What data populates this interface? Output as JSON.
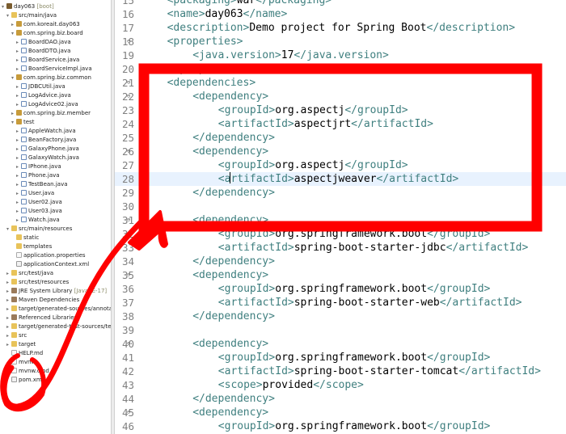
{
  "explorer": {
    "items": [
      {
        "text": "day063",
        "deco": " [boot]",
        "icon": "proj",
        "tw": "v"
      },
      {
        "text": "src/main/java",
        "icon": "folder",
        "tw": "v"
      },
      {
        "text": "com.koreait.day063",
        "icon": "pkg",
        "tw": ">"
      },
      {
        "text": "com.spring.biz.board",
        "icon": "pkg",
        "tw": "v"
      },
      {
        "text": "BoardDAO.java",
        "icon": "java",
        "tw": ">"
      },
      {
        "text": "BoardDTO.java",
        "icon": "java",
        "tw": ">"
      },
      {
        "text": "BoardService.java",
        "icon": "java",
        "tw": ">"
      },
      {
        "text": "BoardServiceImpl.java",
        "icon": "java",
        "tw": ">"
      },
      {
        "text": "com.spring.biz.common",
        "icon": "pkg",
        "tw": "v"
      },
      {
        "text": "JDBCUtil.java",
        "icon": "java",
        "tw": ">"
      },
      {
        "text": "LogAdvice.java",
        "icon": "java",
        "tw": ">"
      },
      {
        "text": "LogAdvice02.java",
        "icon": "java",
        "tw": ">"
      },
      {
        "text": "com.spring.biz.member",
        "icon": "pkg",
        "tw": ">"
      },
      {
        "text": "test",
        "icon": "pkg",
        "tw": "v"
      },
      {
        "text": "AppleWatch.java",
        "icon": "java",
        "tw": ">"
      },
      {
        "text": "BeanFactory.java",
        "icon": "java",
        "tw": ">"
      },
      {
        "text": "GalaxyPhone.java",
        "icon": "java",
        "tw": ">"
      },
      {
        "text": "GalaxyWatch.java",
        "icon": "java",
        "tw": ">"
      },
      {
        "text": "IPhone.java",
        "icon": "java",
        "tw": ">"
      },
      {
        "text": "Phone.java",
        "icon": "java",
        "tw": ">"
      },
      {
        "text": "TestBean.java",
        "icon": "java",
        "tw": ">"
      },
      {
        "text": "User.java",
        "icon": "java",
        "tw": ">"
      },
      {
        "text": "User02.java",
        "icon": "java",
        "tw": ">"
      },
      {
        "text": "User03.java",
        "icon": "java",
        "tw": ">"
      },
      {
        "text": "Watch.java",
        "icon": "java",
        "tw": ">"
      },
      {
        "text": "src/main/resources",
        "icon": "folder",
        "tw": "v"
      },
      {
        "text": "static",
        "icon": "folder",
        "tw": ""
      },
      {
        "text": "templates",
        "icon": "folder",
        "tw": ""
      },
      {
        "text": "application.properties",
        "icon": "file",
        "tw": ""
      },
      {
        "text": "applicationContext.xml",
        "icon": "xml",
        "tw": ""
      },
      {
        "text": "src/test/java",
        "icon": "folder",
        "tw": ">"
      },
      {
        "text": "src/test/resources",
        "icon": "folder",
        "tw": ">"
      },
      {
        "text": "JRE System Library",
        "deco": " [JavaSE-17]",
        "icon": "jar",
        "tw": ">"
      },
      {
        "text": "Maven Dependencies",
        "icon": "jar",
        "tw": ">"
      },
      {
        "text": "target/generated-sources/annotations",
        "icon": "folder",
        "tw": ">"
      },
      {
        "text": "Referenced Libraries",
        "icon": "jar",
        "tw": ">"
      },
      {
        "text": "target/generated-test-sources/test-annotations",
        "icon": "folder",
        "tw": ">"
      },
      {
        "text": "src",
        "icon": "folder",
        "tw": ">"
      },
      {
        "text": "target",
        "icon": "folder",
        "tw": ">"
      },
      {
        "text": "HELP.md",
        "icon": "file",
        "tw": ""
      },
      {
        "text": "mvnw",
        "icon": "file",
        "tw": ""
      },
      {
        "text": "mvnw.cmd",
        "icon": "file",
        "tw": ""
      },
      {
        "text": "pom.xml",
        "icon": "xml",
        "tw": ""
      }
    ]
  },
  "editor": {
    "lines": [
      {
        "n": "15",
        "fold": "",
        "indent": 4,
        "parts": [
          [
            "t",
            "<packaging>"
          ],
          [
            "b",
            "war"
          ],
          [
            "t",
            "</packaging>"
          ]
        ]
      },
      {
        "n": "16",
        "fold": "",
        "indent": 4,
        "parts": [
          [
            "t",
            "<name>"
          ],
          [
            "b",
            "day063"
          ],
          [
            "t",
            "</name>"
          ]
        ]
      },
      {
        "n": "17",
        "fold": "",
        "indent": 4,
        "parts": [
          [
            "t",
            "<description>"
          ],
          [
            "b",
            "Demo project for Spring Boot"
          ],
          [
            "t",
            "</description>"
          ]
        ]
      },
      {
        "n": "18",
        "fold": "⊖",
        "indent": 4,
        "parts": [
          [
            "t",
            "<properties>"
          ]
        ]
      },
      {
        "n": "19",
        "fold": "",
        "indent": 8,
        "parts": [
          [
            "t",
            "<java.version>"
          ],
          [
            "b",
            "17"
          ],
          [
            "t",
            "</java.version>"
          ]
        ]
      },
      {
        "n": "20",
        "fold": "",
        "indent": 4,
        "parts": [
          [
            "t",
            "</properties>"
          ]
        ]
      },
      {
        "n": "21",
        "fold": "⊖",
        "indent": 4,
        "parts": [
          [
            "t",
            "<dependencies>"
          ]
        ]
      },
      {
        "n": "22",
        "fold": "⊖",
        "indent": 8,
        "parts": [
          [
            "t",
            "<dependency>"
          ]
        ]
      },
      {
        "n": "23",
        "fold": "",
        "indent": 12,
        "parts": [
          [
            "t",
            "<groupId>"
          ],
          [
            "b",
            "org.aspectj"
          ],
          [
            "t",
            "</groupId>"
          ]
        ]
      },
      {
        "n": "24",
        "fold": "",
        "indent": 12,
        "parts": [
          [
            "t",
            "<artifactId>"
          ],
          [
            "b",
            "aspectjrt"
          ],
          [
            "t",
            "</artifactId>"
          ]
        ]
      },
      {
        "n": "25",
        "fold": "",
        "indent": 8,
        "parts": [
          [
            "t",
            "</dependency>"
          ]
        ]
      },
      {
        "n": "26",
        "fold": "⊖",
        "indent": 8,
        "parts": [
          [
            "t",
            "<dependency>"
          ]
        ]
      },
      {
        "n": "27",
        "fold": "",
        "indent": 12,
        "parts": [
          [
            "t",
            "<groupId>"
          ],
          [
            "b",
            "org.aspectj"
          ],
          [
            "t",
            "</groupId>"
          ]
        ]
      },
      {
        "n": "28",
        "fold": "",
        "indent": 12,
        "hl": true,
        "caret": 2,
        "parts": [
          [
            "t",
            "<artifactId>"
          ],
          [
            "b",
            "aspectjweaver"
          ],
          [
            "t",
            "</artifactId>"
          ]
        ]
      },
      {
        "n": "29",
        "fold": "",
        "indent": 8,
        "parts": [
          [
            "t",
            "</dependency>"
          ]
        ]
      },
      {
        "n": "30",
        "fold": "",
        "indent": 8,
        "parts": []
      },
      {
        "n": "31",
        "fold": "⊖",
        "indent": 8,
        "parts": [
          [
            "t",
            "<dependency>"
          ]
        ]
      },
      {
        "n": "32",
        "fold": "",
        "indent": 12,
        "parts": [
          [
            "t",
            "<groupId>"
          ],
          [
            "b",
            "org.springframework.boot"
          ],
          [
            "t",
            "</groupId>"
          ]
        ]
      },
      {
        "n": "33",
        "fold": "",
        "indent": 12,
        "parts": [
          [
            "t",
            "<artifactId>"
          ],
          [
            "b",
            "spring-boot-starter-jdbc"
          ],
          [
            "t",
            "</artifactId>"
          ]
        ]
      },
      {
        "n": "34",
        "fold": "",
        "indent": 8,
        "parts": [
          [
            "t",
            "</dependency>"
          ]
        ]
      },
      {
        "n": "35",
        "fold": "⊖",
        "indent": 8,
        "parts": [
          [
            "t",
            "<dependency>"
          ]
        ]
      },
      {
        "n": "36",
        "fold": "",
        "indent": 12,
        "parts": [
          [
            "t",
            "<groupId>"
          ],
          [
            "b",
            "org.springframework.boot"
          ],
          [
            "t",
            "</groupId>"
          ]
        ]
      },
      {
        "n": "37",
        "fold": "",
        "indent": 12,
        "parts": [
          [
            "t",
            "<artifactId>"
          ],
          [
            "b",
            "spring-boot-starter-web"
          ],
          [
            "t",
            "</artifactId>"
          ]
        ]
      },
      {
        "n": "38",
        "fold": "",
        "indent": 8,
        "parts": [
          [
            "t",
            "</dependency>"
          ]
        ]
      },
      {
        "n": "39",
        "fold": "",
        "indent": 0,
        "parts": []
      },
      {
        "n": "40",
        "fold": "⊖",
        "indent": 8,
        "parts": [
          [
            "t",
            "<dependency>"
          ]
        ]
      },
      {
        "n": "41",
        "fold": "",
        "indent": 12,
        "parts": [
          [
            "t",
            "<groupId>"
          ],
          [
            "b",
            "org.springframework.boot"
          ],
          [
            "t",
            "</groupId>"
          ]
        ]
      },
      {
        "n": "42",
        "fold": "",
        "indent": 12,
        "parts": [
          [
            "t",
            "<artifactId>"
          ],
          [
            "b",
            "spring-boot-starter-tomcat"
          ],
          [
            "t",
            "</artifactId>"
          ]
        ]
      },
      {
        "n": "43",
        "fold": "",
        "indent": 12,
        "parts": [
          [
            "t",
            "<scope>"
          ],
          [
            "b",
            "provided"
          ],
          [
            "t",
            "</scope>"
          ]
        ]
      },
      {
        "n": "44",
        "fold": "",
        "indent": 8,
        "parts": [
          [
            "t",
            "</dependency>"
          ]
        ]
      },
      {
        "n": "45",
        "fold": "⊖",
        "indent": 8,
        "parts": [
          [
            "t",
            "<dependency>"
          ]
        ]
      },
      {
        "n": "46",
        "fold": "",
        "indent": 12,
        "parts": [
          [
            "t",
            "<groupId>"
          ],
          [
            "b",
            "org.springframework.boot"
          ],
          [
            "t",
            "</groupId>"
          ]
        ]
      }
    ]
  },
  "annotation": {
    "color": "#ff0000"
  },
  "colors": {
    "tag": "#3f7f7f",
    "text": "#000000",
    "line_numbers": "#808080",
    "current_line": "#e8f2fe"
  }
}
